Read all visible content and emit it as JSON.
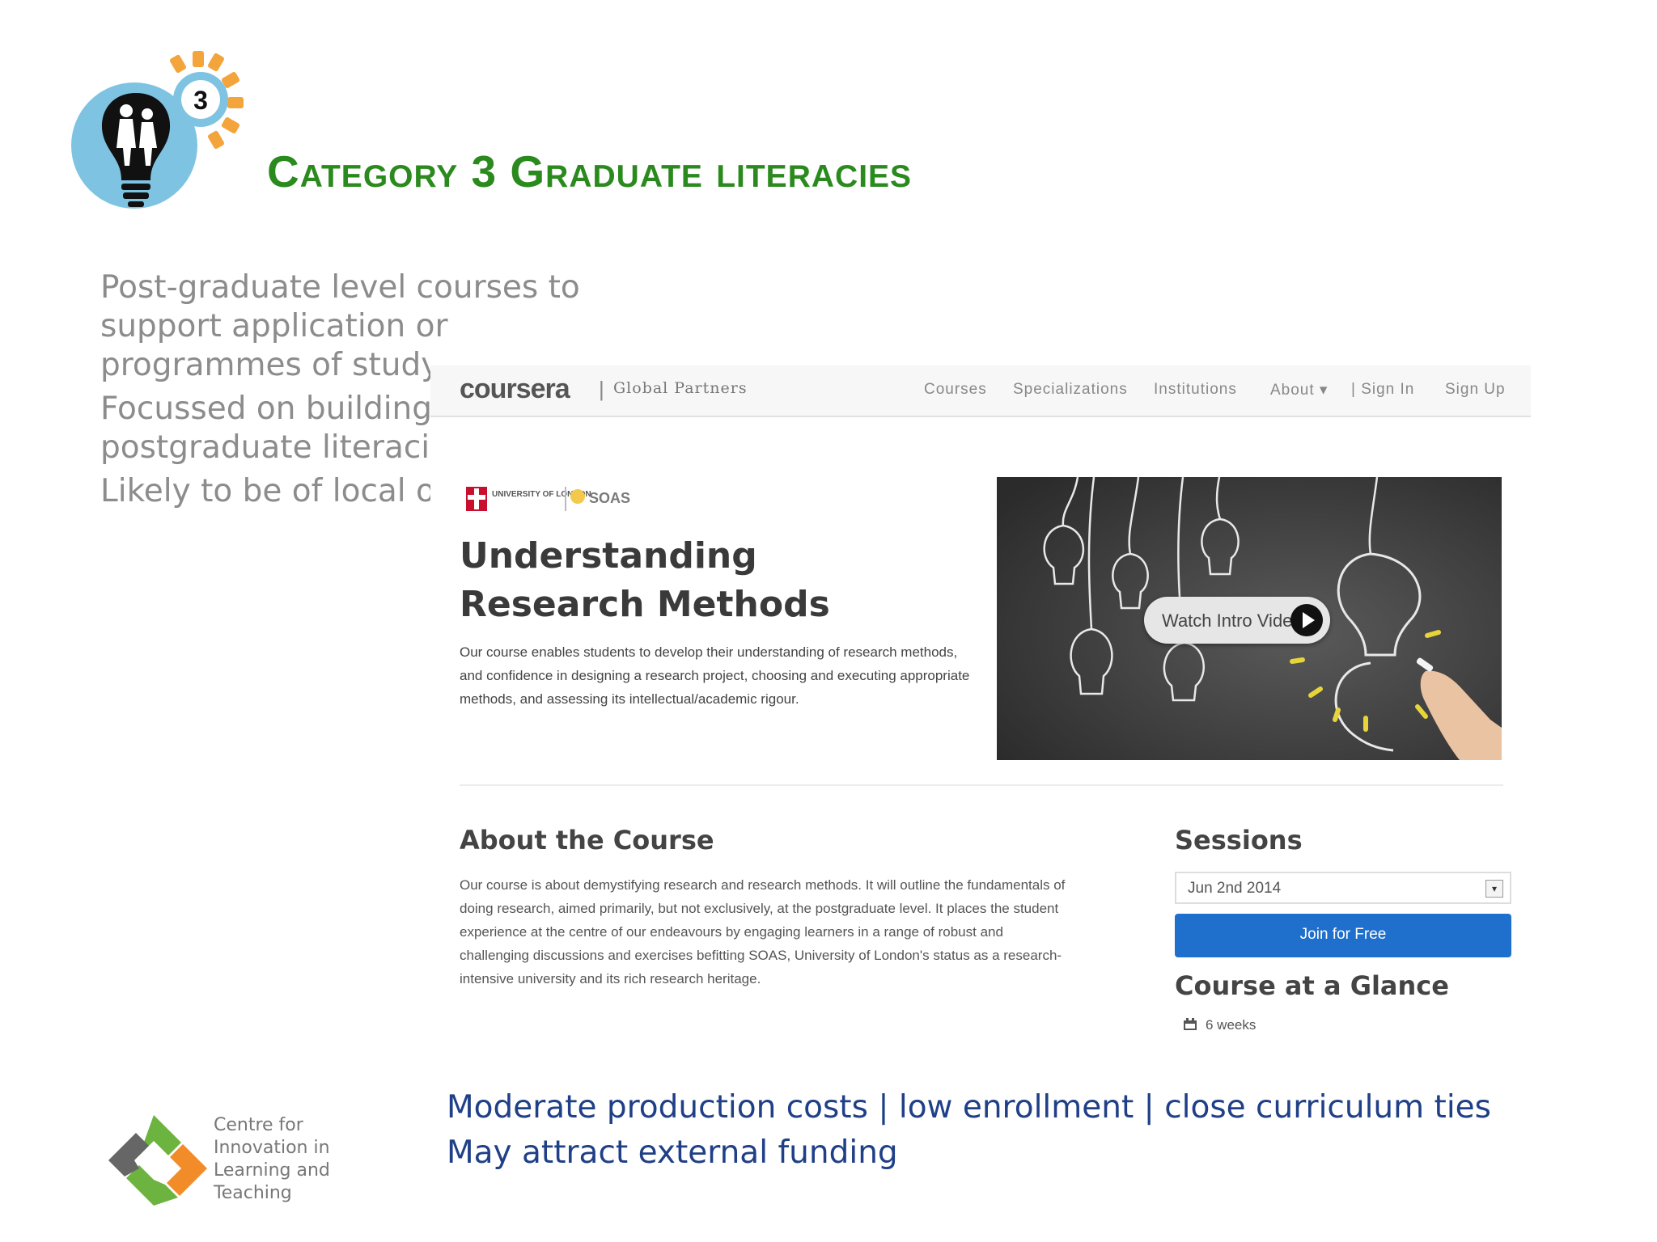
{
  "slide": {
    "title": "Category 3 Graduate literacies",
    "category_number": "3",
    "bullets": [
      "Post-graduate level courses to support application or programmes of study",
      "Focussed on building postgraduate literaci",
      "Likely to be of local o interest."
    ],
    "summary_lines": [
      "Moderate production costs | low enrollment | close curriculum ties",
      "May attract external funding"
    ],
    "footer_org": "Centre for Innovation in Learning and Teaching"
  },
  "screenshot": {
    "nav": {
      "logo": "coursera",
      "separator": "|",
      "partner_label": "Global Partners",
      "links": [
        "Courses",
        "Specializations",
        "Institutions",
        "About ▾",
        "| Sign In",
        "Sign Up"
      ]
    },
    "university_logos": {
      "uol": "UNIVERSITY OF LONDON",
      "soas": "SOAS"
    },
    "course": {
      "title": "Understanding Research Methods",
      "description": "Our course enables students to develop their understanding of research methods, and confidence in designing a research project, choosing and executing appropriate methods, and assessing its intellectual/academic rigour."
    },
    "video": {
      "button_label": "Watch Intro Video"
    },
    "about": {
      "heading": "About the Course",
      "text": "Our course is about demystifying research and research methods. It will outline the fundamentals of doing research, aimed primarily, but not exclusively, at the postgraduate level. It places the student experience at the centre of our endeavours by engaging learners in a range of robust and challenging discussions and exercises befitting SOAS, University of London's status as a research-intensive university and its rich research heritage."
    },
    "sessions": {
      "heading": "Sessions",
      "selected": "Jun 2nd 2014",
      "join_label": "Join for Free",
      "glance_heading": "Course at a Glance",
      "duration": "6 weeks"
    }
  },
  "colors": {
    "title_green": "#2b8a1e",
    "bullet_grey": "#8c8c8c",
    "summary_blue": "#1f3f87",
    "join_blue": "#1f6fcc",
    "icon_blue": "#7fc3e3",
    "icon_orange": "#f3a43a"
  },
  "icons": [
    "lightbulb-people-icon",
    "gear-badge-icon",
    "play-icon",
    "calendar-icon",
    "citl-logo"
  ]
}
